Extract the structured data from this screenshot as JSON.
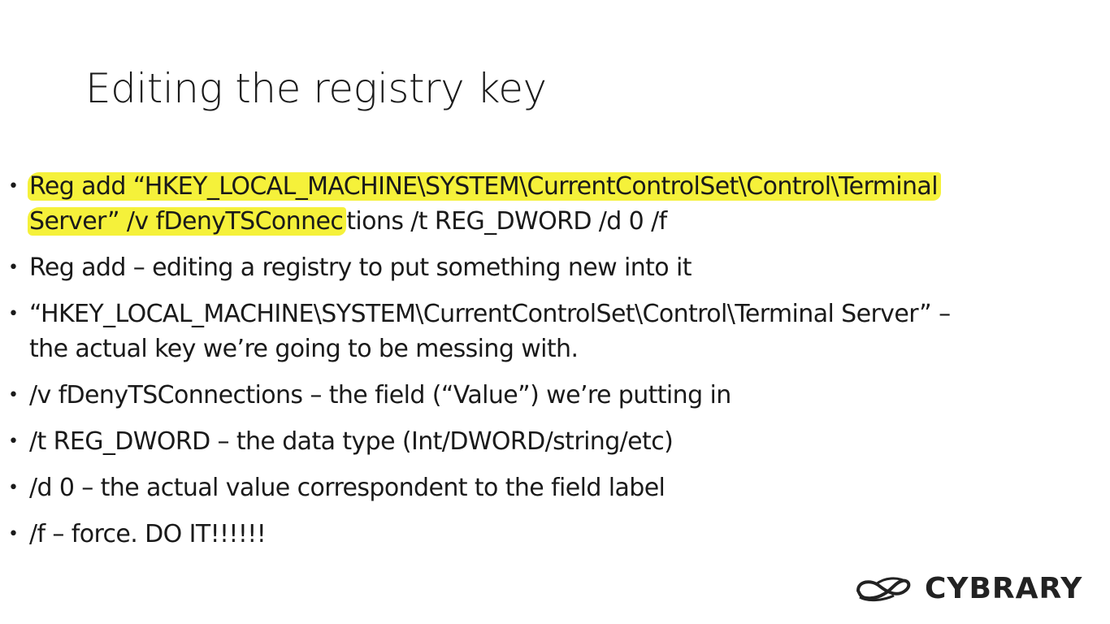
{
  "slide": {
    "title": "Editing the registry key",
    "bullets": [
      {
        "lines": [
          {
            "highlighted": "Reg add “HKEY_LOCAL_MACHINE\\SYSTEM\\CurrentControlSet\\Control\\Terminal",
            "plain": ""
          },
          {
            "highlighted": "Server” /v fDenyTSConnec",
            "plain": "tions /t REG_DWORD /d 0 /f"
          }
        ]
      },
      {
        "lines": [
          {
            "highlighted": "",
            "plain": "Reg add – editing a registry to put something new into it"
          }
        ]
      },
      {
        "lines": [
          {
            "highlighted": "",
            "plain": "“HKEY_LOCAL_MACHINE\\SYSTEM\\CurrentControlSet\\Control\\Terminal Server” –"
          },
          {
            "highlighted": "",
            "plain": "the actual key we’re going to be messing with."
          }
        ]
      },
      {
        "lines": [
          {
            "highlighted": "",
            "plain": "/v fDenyTSConnections – the field (“Value”) we’re putting in"
          }
        ]
      },
      {
        "lines": [
          {
            "highlighted": "",
            "plain": "/t REG_DWORD – the data type (Int/DWORD/string/etc)"
          }
        ]
      },
      {
        "lines": [
          {
            "highlighted": "",
            "plain": "/d 0 – the actual value correspondent to the field label"
          }
        ]
      },
      {
        "lines": [
          {
            "highlighted": "",
            "plain": "/f – force. DO IT!!!!!!"
          }
        ]
      }
    ],
    "highlight_color": "#f5f13a"
  },
  "logo": {
    "icon": "cybrary-logo-icon",
    "text": "CYBRARY"
  }
}
